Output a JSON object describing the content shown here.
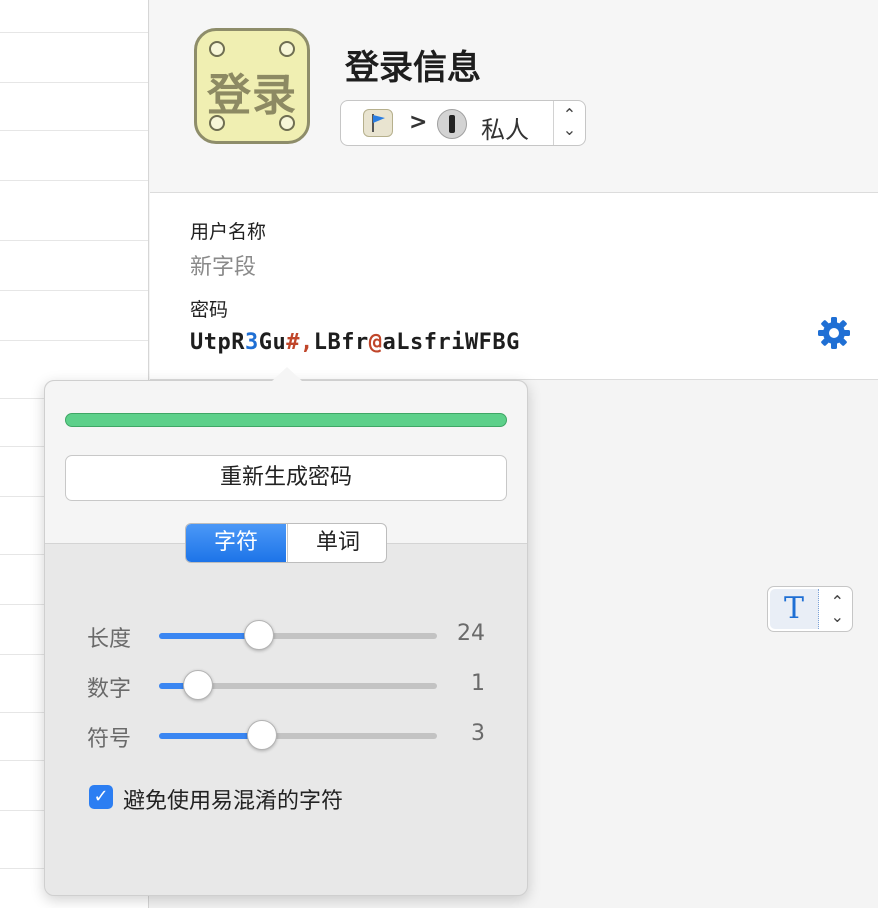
{
  "header": {
    "icon_text": "登录",
    "title": "登录信息",
    "vault": {
      "separator": ">",
      "name": "私人"
    }
  },
  "fields": {
    "username_label": "用户名称",
    "username_value": "新字段",
    "password_label": "密码",
    "password_parts": [
      {
        "text": "UtpR",
        "kind": "normal"
      },
      {
        "text": "3",
        "kind": "number"
      },
      {
        "text": "Gu",
        "kind": "normal"
      },
      {
        "text": "#,",
        "kind": "symbol"
      },
      {
        "text": "LBfr",
        "kind": "normal"
      },
      {
        "text": "@",
        "kind": "symbol"
      },
      {
        "text": "aLsfriWFBG",
        "kind": "normal"
      }
    ]
  },
  "generator": {
    "strength_fraction": 1.0,
    "regenerate_label": "重新生成密码",
    "modes": [
      {
        "label": "字符",
        "selected": true
      },
      {
        "label": "单词",
        "selected": false
      }
    ],
    "sliders": [
      {
        "label": "长度",
        "value": "24",
        "fraction": 0.36
      },
      {
        "label": "数字",
        "value": "1",
        "fraction": 0.14
      },
      {
        "label": "符号",
        "value": "3",
        "fraction": 0.37
      }
    ],
    "avoid_ambiguous": {
      "label": "避免使用易混淆的字符",
      "checked": true
    }
  },
  "colors": {
    "accent": "#1f6fd4",
    "strength": "#5dd08a",
    "password_number": "#1f6fd4",
    "password_symbol": "#c0462a"
  },
  "icons": {
    "gear": "gear-icon",
    "format": "text-format-icon",
    "check": "checkmark-icon"
  }
}
